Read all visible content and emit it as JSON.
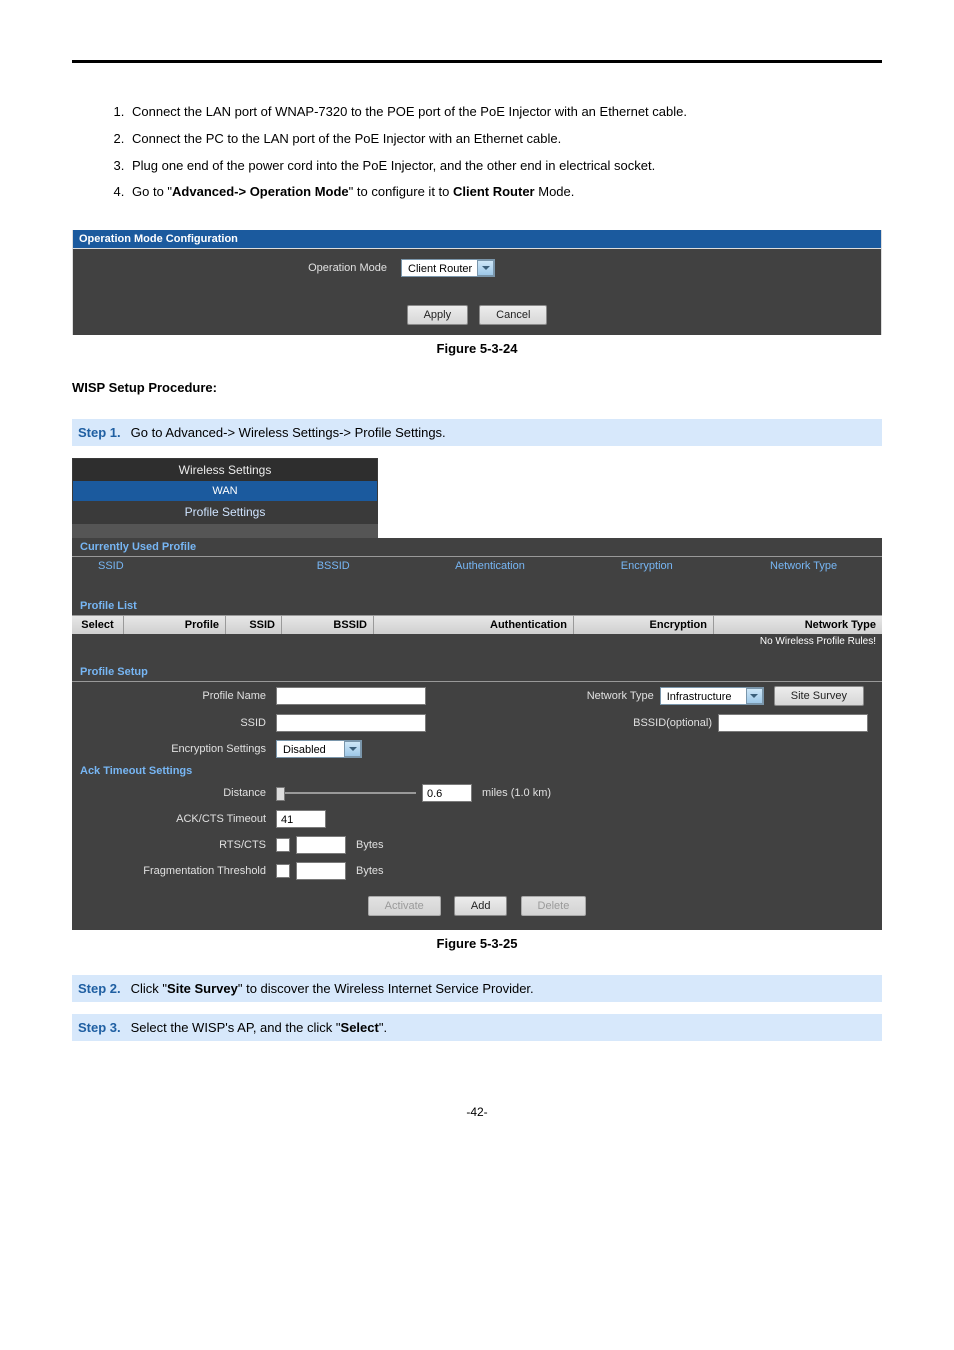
{
  "list": {
    "i1": "Connect the LAN port of WNAP-7320 to the POE port of the PoE Injector with an Ethernet cable.",
    "i2": "Connect the PC to the LAN port of the PoE Injector with an Ethernet cable.",
    "i3": "Plug one end of the power cord into the PoE Injector, and the other end in electrical socket.",
    "i4_a": "Go to \"",
    "i4_b": "Advanced-> Operation Mode",
    "i4_c": "\" to configure it to ",
    "i4_d": "Client Router",
    "i4_e": " Mode."
  },
  "fig1": {
    "title_bar": "Operation Mode Configuration",
    "label": "Operation Mode",
    "value": "Client Router",
    "apply": "Apply",
    "cancel": "Cancel",
    "caption": "Figure 5-3-24"
  },
  "wisp_head": "WISP Setup Procedure:",
  "step1": {
    "label": "Step 1.",
    "text": "Go to Advanced-> Wireless Settings-> Profile Settings."
  },
  "wsnav": {
    "r1": "Wireless Settings",
    "r2": "WAN",
    "r3": "Profile Settings"
  },
  "panel2": {
    "currently_used": "Currently Used Profile",
    "h_ssid": "SSID",
    "h_bssid": "BSSID",
    "h_auth": "Authentication",
    "h_enc": "Encryption",
    "h_net": "Network Type",
    "profile_list": "Profile List",
    "t_select": "Select",
    "t_profile": "Profile",
    "t_ssid": "SSID",
    "t_bssid": "BSSID",
    "t_auth": "Authentication",
    "t_enc": "Encryption",
    "t_net": "Network Type",
    "empty": "No Wireless Profile Rules!",
    "profile_setup": "Profile Setup",
    "f_profile_name": "Profile Name",
    "f_network_type": "Network Type",
    "v_network_type": "Infrastructure",
    "btn_site": "Site Survey",
    "f_ssid": "SSID",
    "f_bssid_opt": "BSSID(optional)",
    "f_enc": "Encryption Settings",
    "v_enc": "Disabled",
    "ack_title": "Ack Timeout Settings",
    "f_distance": "Distance",
    "v_distance": "0.6",
    "dist_units": "miles (1.0 km)",
    "f_ackcts": "ACK/CTS Timeout",
    "v_ackcts": "41",
    "f_rtscts": "RTS/CTS",
    "bytes": "Bytes",
    "f_frag": "Fragmentation Threshold",
    "btn_activate": "Activate",
    "btn_add": "Add",
    "btn_delete": "Delete",
    "caption": "Figure 5-3-25"
  },
  "step2": {
    "label": "Step 2.",
    "t_a": "Click \"",
    "t_b": "Site Survey",
    "t_c": "\" to discover the Wireless Internet Service Provider."
  },
  "step3": {
    "label": "Step 3.",
    "t_a": "Select the WISP's AP, and the click \"",
    "t_b": "Select",
    "t_c": "\"."
  },
  "page_num": "-42-"
}
